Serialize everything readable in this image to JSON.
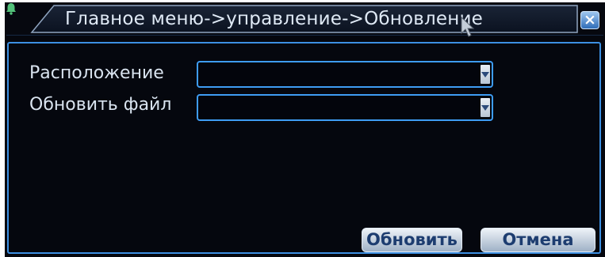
{
  "window": {
    "title": "Главное меню->управление->Обновление",
    "close_symbol": "×",
    "title_icon": "bell-icon"
  },
  "form": {
    "location_label": "Расположение",
    "location_value": "",
    "file_label": "Обновить файл",
    "file_value": ""
  },
  "buttons": {
    "update_label": "Обновить",
    "cancel_label": "Отмена"
  },
  "colors": {
    "background": "#05070e",
    "accent": "#3c8fe2",
    "text": "#d9e3ef"
  }
}
